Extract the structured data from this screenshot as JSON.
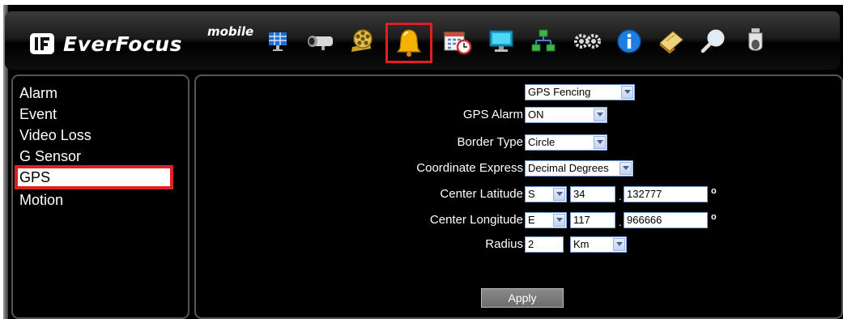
{
  "brand": {
    "name": "EverFocus",
    "suffix": "mobile"
  },
  "toolbar": {
    "items": [
      {
        "name": "grid-icon",
        "active": false
      },
      {
        "name": "camera-icon",
        "active": false
      },
      {
        "name": "film-reel-icon",
        "active": false
      },
      {
        "name": "bell-icon",
        "active": true
      },
      {
        "name": "schedule-calendar-icon",
        "active": false
      },
      {
        "name": "monitor-icon",
        "active": false
      },
      {
        "name": "network-icon",
        "active": false
      },
      {
        "name": "gears-icon",
        "active": false
      },
      {
        "name": "info-icon",
        "active": false
      },
      {
        "name": "notes-icon",
        "active": false
      },
      {
        "name": "magnifier-icon",
        "active": false
      },
      {
        "name": "dome-camera-icon",
        "active": false
      }
    ]
  },
  "sidebar": {
    "items": [
      {
        "label": "Alarm"
      },
      {
        "label": "Event"
      },
      {
        "label": "Video Loss"
      },
      {
        "label": "G Sensor"
      },
      {
        "label": "GPS"
      },
      {
        "label": "Motion"
      }
    ],
    "active": "GPS"
  },
  "form": {
    "mode": {
      "value": "GPS Fencing"
    },
    "gps_alarm": {
      "label": "GPS Alarm",
      "value": "ON"
    },
    "border_type": {
      "label": "Border Type",
      "value": "Circle"
    },
    "coordinate_express": {
      "label": "Coordinate Express",
      "value": "Decimal Degrees"
    },
    "center_latitude": {
      "label": "Center Latitude",
      "hemisphere": "S",
      "degrees": "34",
      "decimal": "132777",
      "separator": ".",
      "unit": "o"
    },
    "center_longitude": {
      "label": "Center Longitude",
      "hemisphere": "E",
      "degrees": "117",
      "decimal": "966666",
      "separator": ".",
      "unit": "o"
    },
    "radius": {
      "label": "Radius",
      "value": "2",
      "unit": "Km"
    },
    "apply_label": "Apply"
  },
  "colors": {
    "highlight": "#e01e24",
    "background": "#000000",
    "bell": "#f5b300"
  }
}
